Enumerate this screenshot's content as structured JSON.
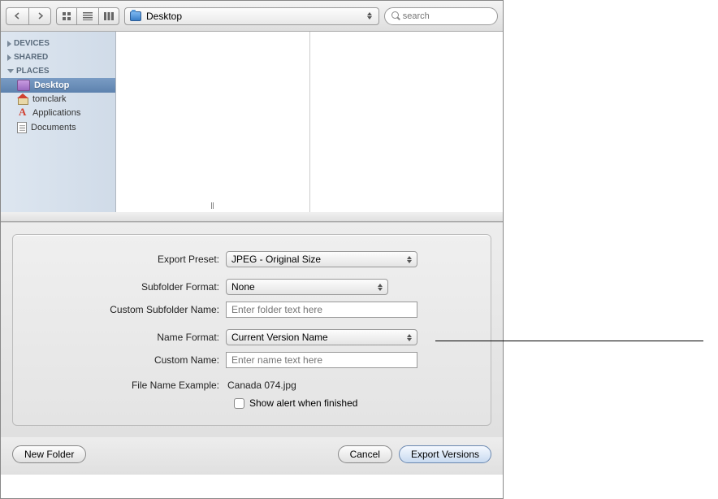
{
  "toolbar": {
    "location_label": "Desktop",
    "search_placeholder": "search"
  },
  "sidebar": {
    "sections": [
      {
        "label": "DEVICES",
        "expanded": false
      },
      {
        "label": "SHARED",
        "expanded": false
      },
      {
        "label": "PLACES",
        "expanded": true
      }
    ],
    "places": [
      {
        "label": "Desktop",
        "selected": true,
        "icon": "desktop"
      },
      {
        "label": "tomclark",
        "selected": false,
        "icon": "home"
      },
      {
        "label": "Applications",
        "selected": false,
        "icon": "app"
      },
      {
        "label": "Documents",
        "selected": false,
        "icon": "docs"
      }
    ]
  },
  "form": {
    "export_preset": {
      "label": "Export Preset:",
      "value": "JPEG - Original Size"
    },
    "subfolder_format": {
      "label": "Subfolder Format:",
      "value": "None"
    },
    "custom_subfolder": {
      "label": "Custom Subfolder Name:",
      "placeholder": "Enter folder text here"
    },
    "name_format": {
      "label": "Name Format:",
      "value": "Current Version Name"
    },
    "custom_name": {
      "label": "Custom Name:",
      "placeholder": "Enter name text here"
    },
    "filename_example": {
      "label": "File Name Example:",
      "value": "Canada 074.jpg"
    },
    "show_alert": {
      "label": "Show alert when finished",
      "checked": false
    }
  },
  "buttons": {
    "new_folder": "New Folder",
    "cancel": "Cancel",
    "export": "Export Versions"
  }
}
